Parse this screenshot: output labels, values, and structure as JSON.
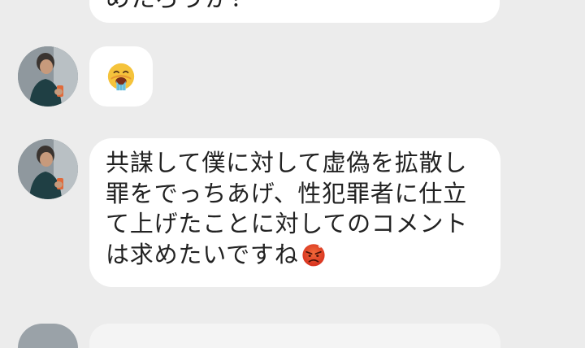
{
  "chat": {
    "top_message_fragment": "めたろうか？",
    "emoji_message_icon": "vomiting-face-icon",
    "main_message": "共謀して僕に対して虚偽を拡散し\n罪をでっちあげ、性犯罪者に仕立\nて上げたことに対してのコメント\nは求めたいですね",
    "main_message_trailing_emoji": "angry-face-icon"
  },
  "colors": {
    "background": "#ececec",
    "bubble": "#ffffff",
    "text": "#222222"
  }
}
